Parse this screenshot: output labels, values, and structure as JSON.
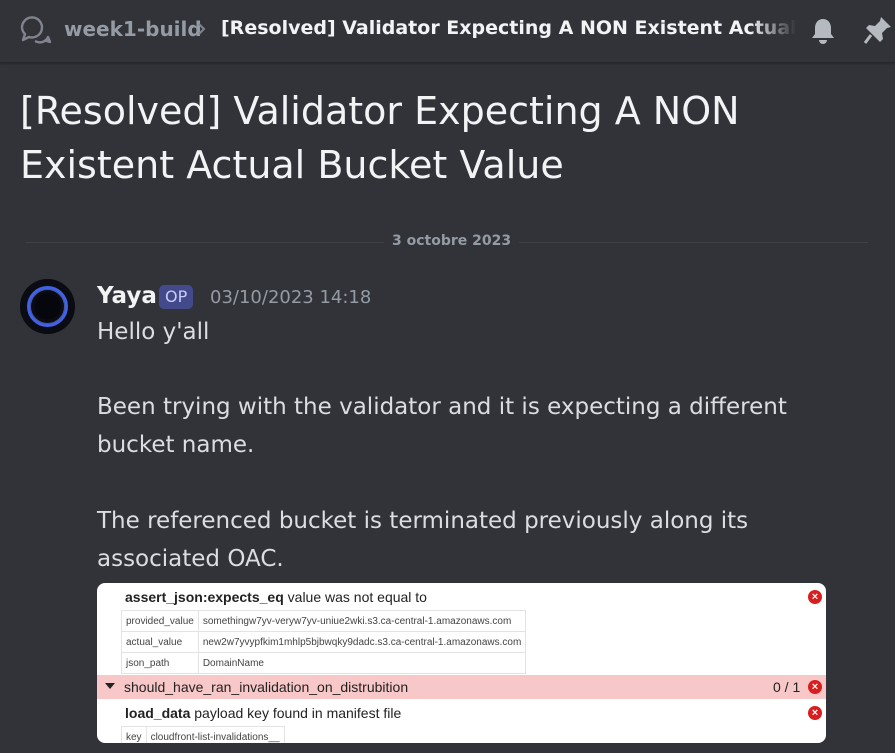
{
  "header": {
    "channel": "week1-build",
    "thread_title": "[Resolved] Validator Expecting A NON Existent Actual Bucket Value"
  },
  "post": {
    "title": "[Resolved] Validator Expecting A NON Existent Actual Bucket Value",
    "date_divider": "3 octobre 2023"
  },
  "message": {
    "author": "Yaya",
    "badge": "OP",
    "timestamp": "03/10/2023 14:18",
    "lines": [
      "Hello y'all",
      "Been trying with the validator and it is expecting a different",
      "bucket name.",
      "The referenced bucket is terminated previously along its",
      "associated OAC."
    ]
  },
  "attachment": {
    "check1": {
      "name": "assert_json:expects_eq",
      "message": "value was not equal to",
      "rows": [
        {
          "key": "provided_value",
          "value": "somethingw7yv-veryw7yv-uniue2wki.s3.ca-central-1.amazonaws.com"
        },
        {
          "key": "actual_value",
          "value": "new2w7yvypfkim1mhlp5bjbwqky9dadc.s3.ca-central-1.amazonaws.com"
        },
        {
          "key": "json_path",
          "value": "DomainName"
        }
      ]
    },
    "failing_group": {
      "label": "should_have_ran_invalidation_on_distrubition",
      "count": "0 / 1"
    },
    "check2": {
      "name": "load_data",
      "message": "payload key found in manifest file",
      "rows": [
        {
          "key": "key",
          "value": "cloudfront-list-invalidations__"
        }
      ]
    },
    "error_glyph": "×"
  },
  "colors": {
    "background": "#313338",
    "op_badge": "#5865f2",
    "fail_bar": "#f8c7c7",
    "error": "#d91e1e"
  },
  "icons": {
    "thread": "thread-icon",
    "separator": "chevron-right-icon",
    "notifications": "bell-icon",
    "pins": "pin-icon",
    "error": "error-circle-icon",
    "expand": "caret-down-icon"
  }
}
